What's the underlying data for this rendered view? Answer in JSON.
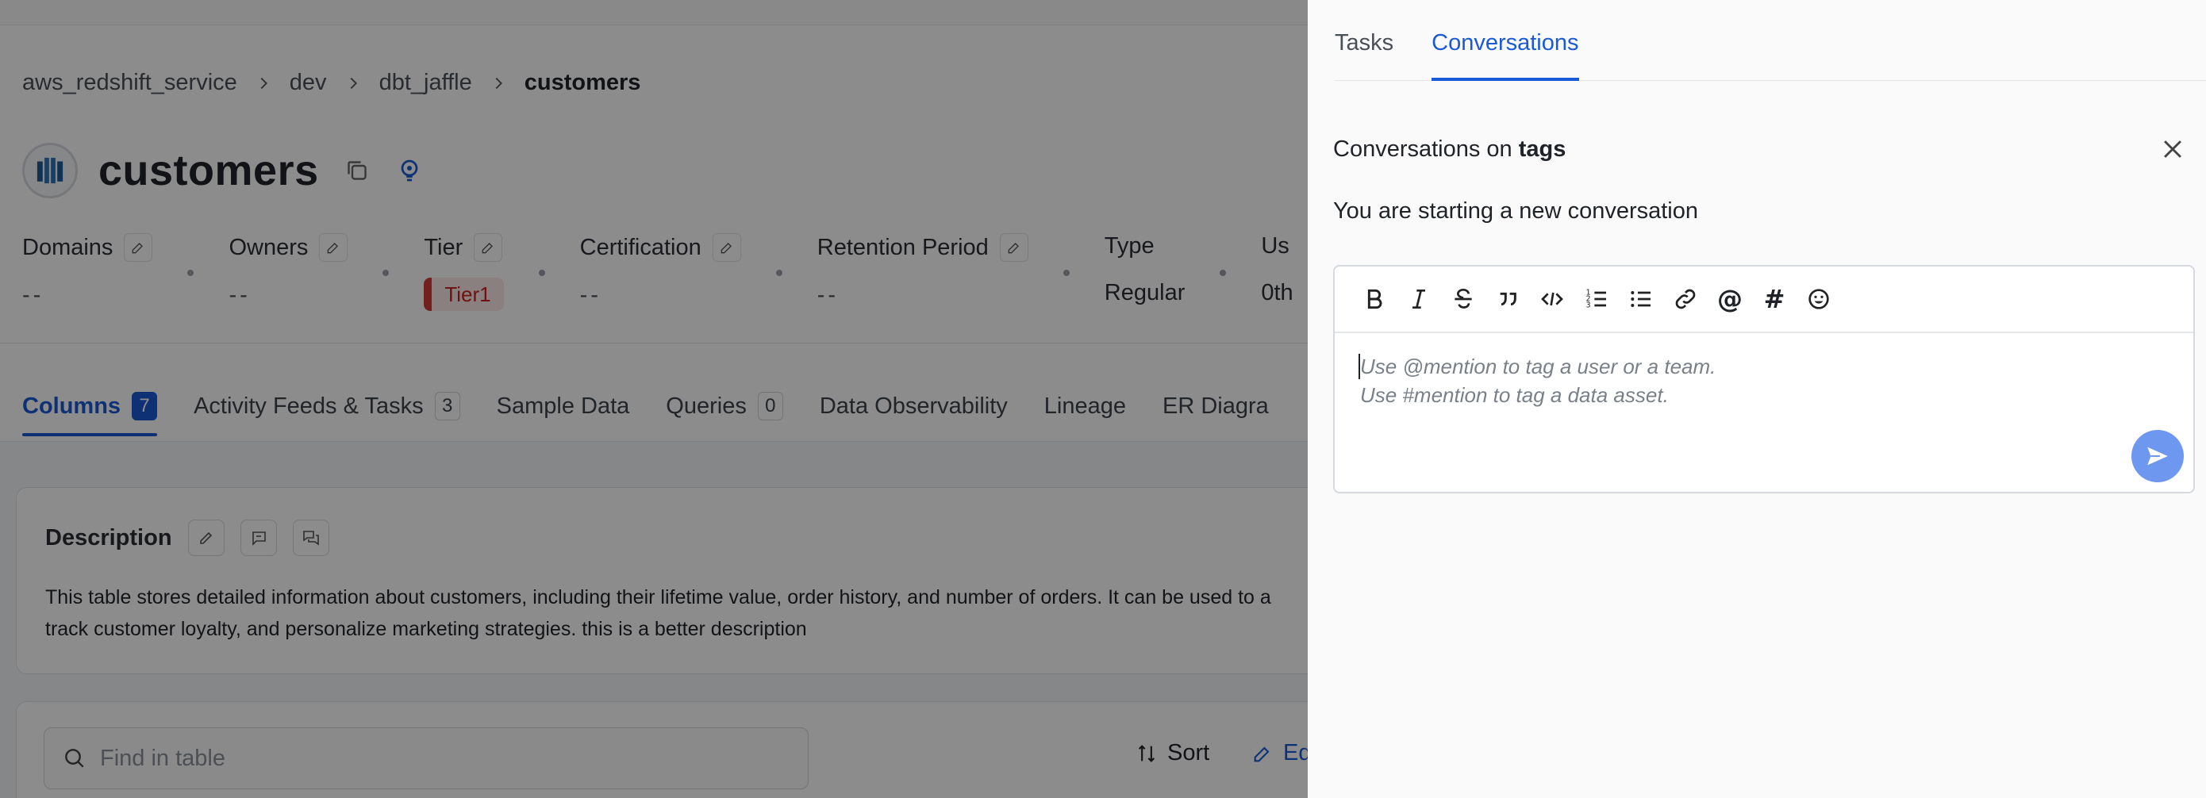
{
  "breadcrumb": {
    "items": [
      "aws_redshift_service",
      "dev",
      "dbt_jaffle",
      "customers"
    ]
  },
  "entity": {
    "title": "customers",
    "logo_icon": "redshift-logo-icon"
  },
  "properties": {
    "domains": {
      "label": "Domains",
      "value": "--"
    },
    "owners": {
      "label": "Owners",
      "value": "--"
    },
    "tier": {
      "label": "Tier",
      "value": "Tier1"
    },
    "certification": {
      "label": "Certification",
      "value": "--"
    },
    "retention": {
      "label": "Retention Period",
      "value": "--"
    },
    "type": {
      "label": "Type",
      "value": "Regular"
    },
    "usage": {
      "label": "Us",
      "value": "0th"
    }
  },
  "tabs": [
    {
      "label": "Columns",
      "count": "7"
    },
    {
      "label": "Activity Feeds & Tasks",
      "count": "3"
    },
    {
      "label": "Sample Data"
    },
    {
      "label": "Queries",
      "count": "0"
    },
    {
      "label": "Data Observability"
    },
    {
      "label": "Lineage"
    },
    {
      "label": "ER Diagra"
    }
  ],
  "description": {
    "title": "Description",
    "line1": "This table stores detailed information about customers, including their lifetime value, order history, and number of orders. It can be used to a",
    "line2": "track customer loyalty, and personalize marketing strategies. this is a better description"
  },
  "table_toolbar": {
    "search_placeholder": "Find in table",
    "sort_label": "Sort",
    "edit_label": "Ed"
  },
  "drawer": {
    "tabs": [
      "Tasks",
      "Conversations"
    ],
    "active_tab": "Conversations",
    "heading_prefix": "Conversations on",
    "heading_target": "tags",
    "subheading": "You are starting a new conversation",
    "editor": {
      "placeholder_line1": "Use @mention to tag a user or a team.",
      "placeholder_line2": "Use #mention to tag a data asset.",
      "toolbar": [
        "bold-icon",
        "italic-icon",
        "strikethrough-icon",
        "quote-icon",
        "code-icon",
        "ordered-list-icon",
        "bullet-list-icon",
        "link-icon",
        "mention-icon",
        "hashtag-icon",
        "emoji-icon"
      ]
    }
  },
  "colors": {
    "accent": "#1a5ad6",
    "overlay": "rgba(0,0,0,0.45)",
    "tier_badge_bg": "#fde9e9",
    "tier_badge_text": "#cc2222",
    "send_button": "#6e98f0"
  }
}
